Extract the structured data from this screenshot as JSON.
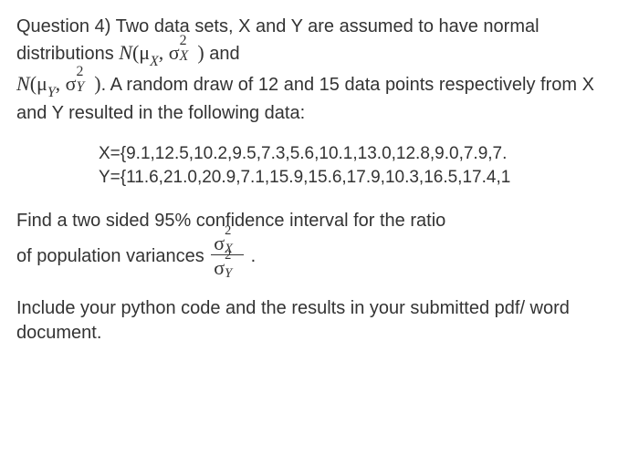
{
  "q": {
    "prefix": "Question 4) ",
    "intro1": "Two data sets, X and Y are assumed to have normal distributions ",
    "and": " and",
    "intro2": ". A random draw of 12 and 15 data points respectively from X and Y resulted in the following data:",
    "dataX": "X={9.1,12.5,10.2,9.5,7.3,5.6,10.1,13.0,12.8,9.0,7.9,7.",
    "dataY": "Y={11.6,21.0,20.9,7.1,15.9,15.6,17.9,10.3,16.5,17.4,1",
    "find1": "Find a two sided 95% confidence interval for the ratio",
    "find2a": "of population variances ",
    "period": " .",
    "include": "Include your python code and the results in your submitted pdf/ word document."
  },
  "sym": {
    "N": "N",
    "mu": "μ",
    "sigma": "σ",
    "X": "X",
    "Y": "Y",
    "two": "2",
    "comma": ", ",
    "lp": "(",
    "rp": ")"
  }
}
